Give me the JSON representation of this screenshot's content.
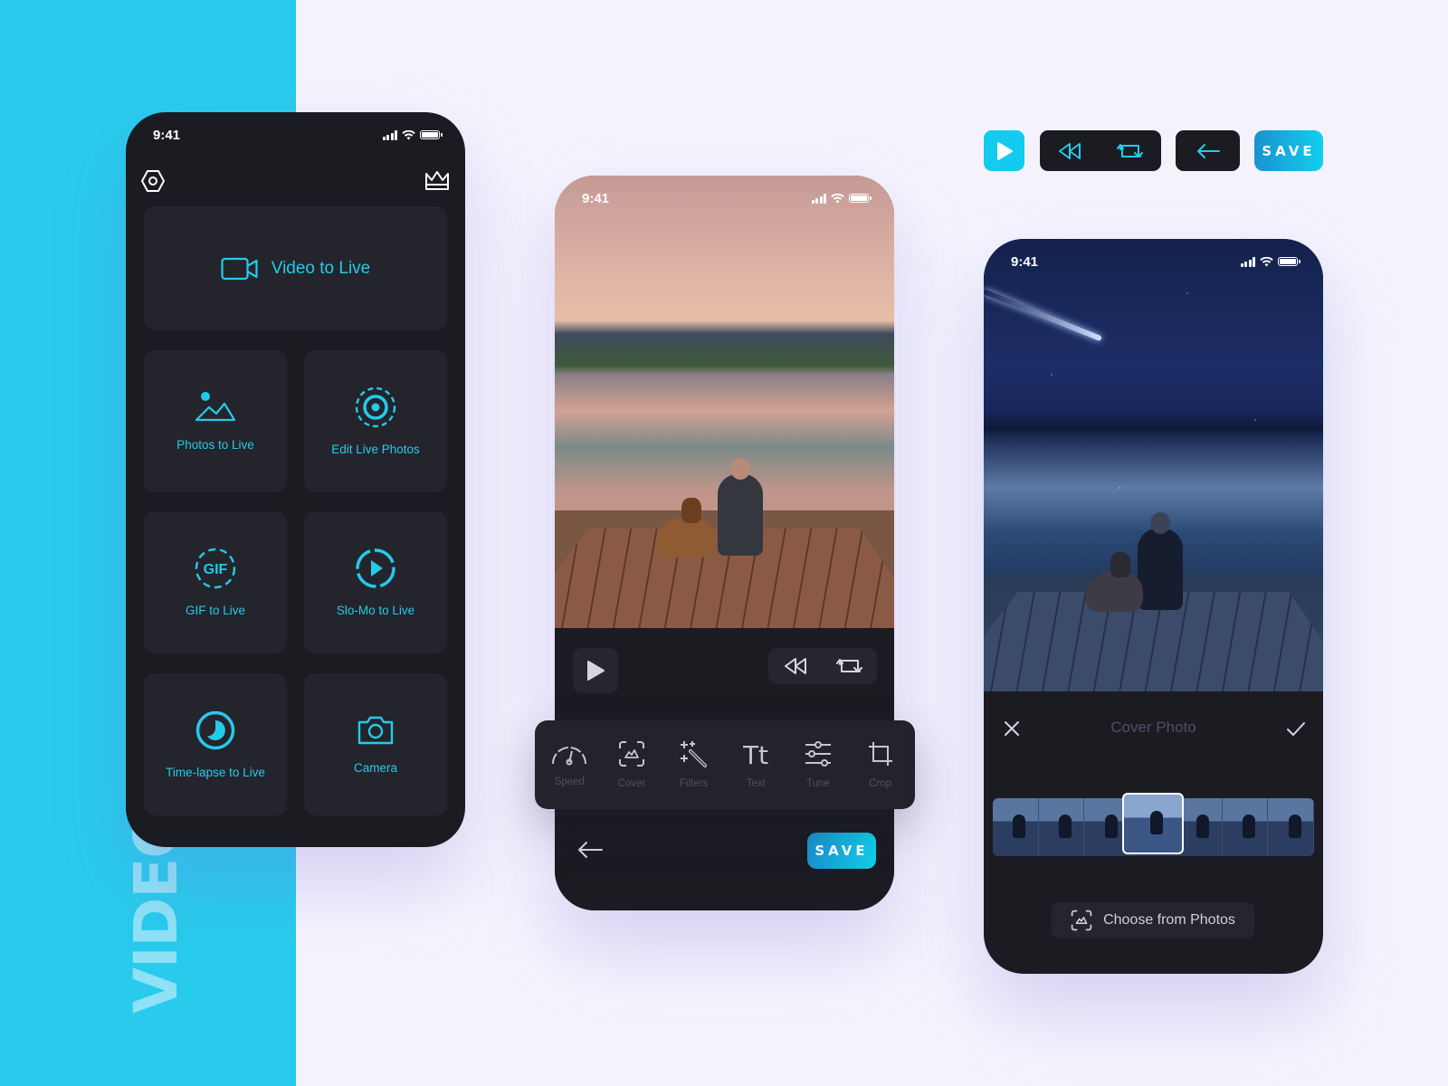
{
  "banner": {
    "title": "VIDEO TO LIVE IOS APP",
    "accent": "#28cbec"
  },
  "status": {
    "time": "9:41"
  },
  "home_phone": {
    "header": {
      "left_icon": "settings-hexagon-icon",
      "right_icon": "crown-icon"
    },
    "primary_tile": {
      "label": "Video to Live",
      "icon": "video-camera-icon"
    },
    "tiles": [
      {
        "label": "Photos to Live",
        "icon": "image-icon"
      },
      {
        "label": "Edit Live Photos",
        "icon": "live-photo-icon"
      },
      {
        "label": "GIF to Live",
        "icon": "gif-icon",
        "icon_text": "GIF"
      },
      {
        "label": "Slo-Mo to Live",
        "icon": "slomo-play-icon"
      },
      {
        "label": "Time-lapse to Live",
        "icon": "timelapse-icon"
      },
      {
        "label": "Camera",
        "icon": "camera-icon"
      }
    ],
    "accent": "#24cbe9"
  },
  "editor_phone": {
    "controls": {
      "play": "play-icon",
      "rewind": "rewind-icon",
      "loop": "loop-icon"
    },
    "tools": [
      {
        "label": "Speed",
        "icon": "speedometer-icon"
      },
      {
        "label": "Cover",
        "icon": "cover-icon"
      },
      {
        "label": "Filters",
        "icon": "magic-wand-icon"
      },
      {
        "label": "Text",
        "icon": "text-icon",
        "icon_text": "Tt"
      },
      {
        "label": "Tune",
        "icon": "sliders-icon"
      },
      {
        "label": "Crop",
        "icon": "crop-icon"
      }
    ],
    "back_icon": "arrow-left-icon",
    "save_label": "SAVE"
  },
  "component_sheet": {
    "save_label": "SAVE"
  },
  "cover_phone": {
    "title": "Cover Photo",
    "close_icon": "close-icon",
    "confirm_icon": "check-icon",
    "filmstrip_frames": 7,
    "selected_frame": 4,
    "choose_label": "Choose from Photos"
  }
}
